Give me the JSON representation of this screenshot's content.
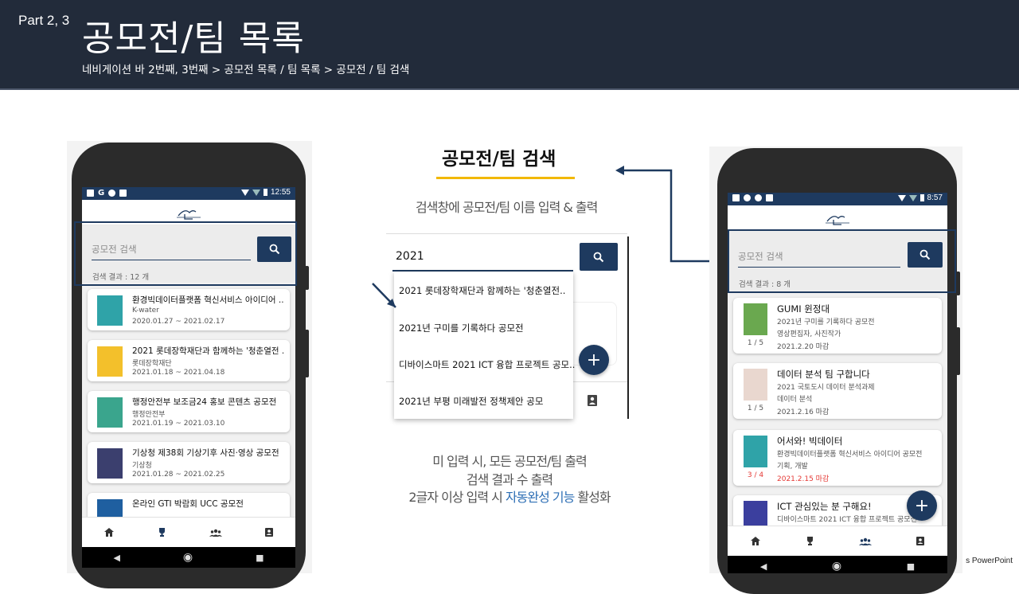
{
  "slide": {
    "part_label": "Part 2, 3",
    "title": "공모전/팀 목록",
    "subtitle": "네비게이션 바 2번째, 3번째 > 공모전 목록 / 팀 목록  > 공모전 / 팀 검색"
  },
  "center": {
    "title": "공모전/팀 검색",
    "caption": "검색창에 공모전/팀 이름 입력 & 출력",
    "search_value": "2021",
    "suggestions": [
      "2021 롯데장학재단과 함께하는 '청춘열전..",
      "2021년 구미를 기록하다 공모전",
      "디바이스마트 2021 ICT 융합 프로젝트 공모..",
      "2021년 부평 미래발전 정책제안 공모"
    ],
    "bottom_caption_1": "미 입력 시, 모든 공모전/팀 출력",
    "bottom_caption_2": "검색 결과 수 출력",
    "bottom_caption_3_pre": "2글자 이상 입력 시 ",
    "bottom_caption_3_accent": "자동완성 기능",
    "bottom_caption_3_post": " 활성화",
    "accent_color": "#2e6fb5"
  },
  "left_phone": {
    "time": "12:55",
    "search_placeholder": "공모전 검색",
    "result_count": "검색 결과 :  12 개",
    "items": [
      {
        "title": "환경빅데이터플랫폼 혁신서비스 아이디어 ...",
        "org": "K-water",
        "date": "2020.01.27  ~  2021.02.17",
        "thumb_color": "#2fa3a8"
      },
      {
        "title": "2021 롯데장학재단과 함께하는 '청춘열전 ...",
        "org": "롯데장학재단",
        "date": "2021.01.18  ~  2021.04.18",
        "thumb_color": "#f3c02b"
      },
      {
        "title": "행정안전부 보조금24 홍보 콘텐츠 공모전",
        "org": "행정안전부",
        "date": "2021.01.19  ~  2021.03.10",
        "thumb_color": "#3aa58d"
      },
      {
        "title": "기상청 제38회 기상기후 사진·영상 공모전",
        "org": "기상청",
        "date": "2021.01.28  ~  2021.02.25",
        "thumb_color": "#3b3f6e"
      },
      {
        "title": "온라인 GTI 박람회 UCC 공모전",
        "org": "",
        "date": "",
        "thumb_color": "#1f5fa0"
      }
    ]
  },
  "right_phone": {
    "time": "8:57",
    "search_placeholder": "공모전 검색",
    "result_count": "검색 결과 :  8 개",
    "items": [
      {
        "title": "GUMI 윈정대",
        "line1": "2021년 구미를 기록하다 공모전",
        "line2": "영상편집자, 사진작가",
        "deadline": "2021.2.20 마감",
        "fraction": "1 / 5",
        "urgent": false,
        "thumb_color": "#6aa84f"
      },
      {
        "title": "데이터 분석 팀 구합니다",
        "line1": "2021 국토도시 데이터 분석과제",
        "line2": "데이터 분석",
        "deadline": "2021.2.16 마감",
        "fraction": "1 / 5",
        "urgent": false,
        "thumb_color": "#e9d7cf"
      },
      {
        "title": "어서와! 빅데이터",
        "line1": "환경빅데이터플랫폼 혁신서비스 아이디어 공모전",
        "line2": "기획, 개발",
        "deadline": "2021.2.15 마감",
        "fraction": "3 / 4",
        "urgent": true,
        "thumb_color": "#2fa3a8"
      },
      {
        "title": "ICT 관심있는 분 구해요!",
        "line1": "디바이스마트 2021 ICT 융합 프로젝트 공모전",
        "line2": "",
        "deadline": "",
        "fraction": "",
        "urgent": false,
        "thumb_color": "#3b3f9e"
      }
    ],
    "urgent_color": "#e53935"
  },
  "watermark": "s PowerPoint"
}
